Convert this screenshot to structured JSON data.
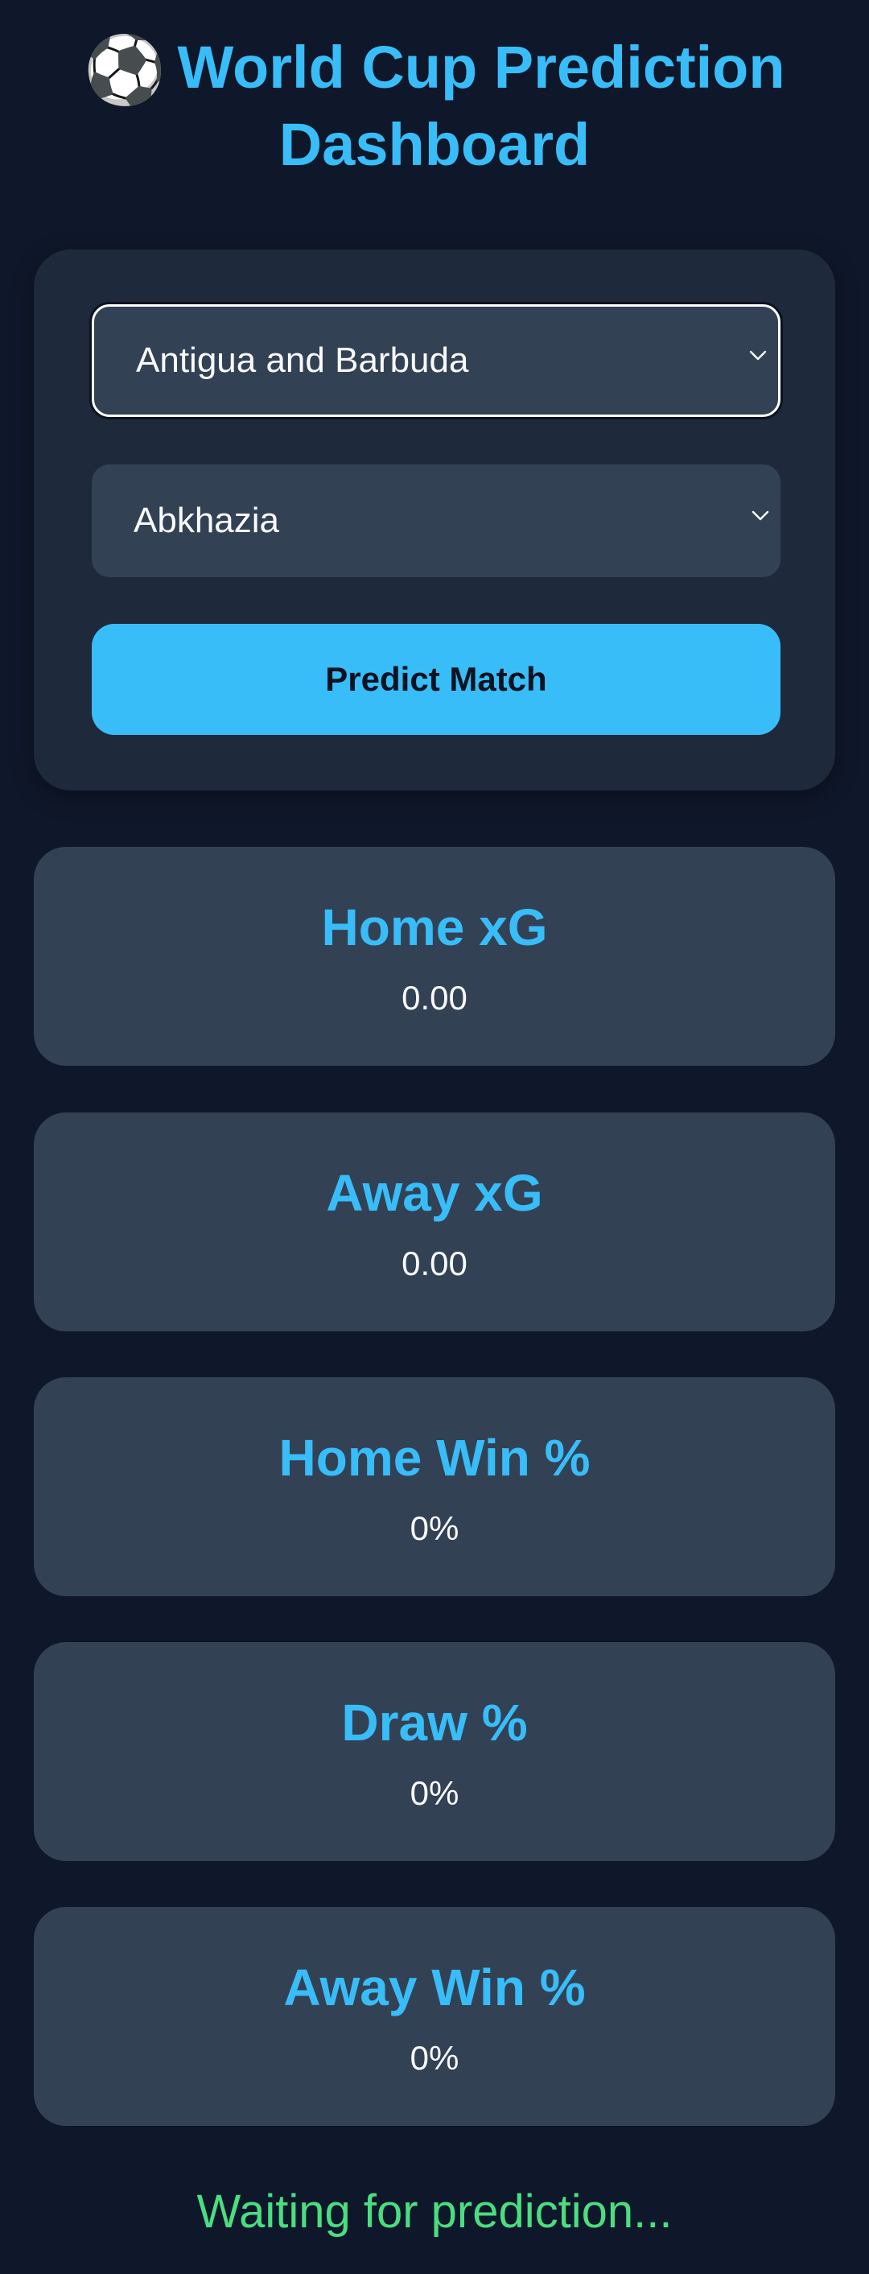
{
  "header": {
    "icon": "soccer-ball-icon",
    "emoji": "⚽",
    "title_line1": "World Cup Prediction",
    "title_line2": "Dashboard"
  },
  "controls": {
    "home_team": "Antigua and Barbuda",
    "away_team": "Abkhazia",
    "predict_label": "Predict Match"
  },
  "stats": {
    "home_xg": {
      "label": "Home xG",
      "value": "0.00"
    },
    "away_xg": {
      "label": "Away xG",
      "value": "0.00"
    },
    "home_win": {
      "label": "Home Win %",
      "value": "0%"
    },
    "draw": {
      "label": "Draw %",
      "value": "0%"
    },
    "away_win": {
      "label": "Away Win %",
      "value": "0%"
    }
  },
  "status": {
    "text": "Waiting for prediction..."
  },
  "colors": {
    "background": "#0f172a",
    "panel": "#1e293b",
    "card": "#334155",
    "accent": "#38bdf8",
    "status": "#4ade80"
  }
}
